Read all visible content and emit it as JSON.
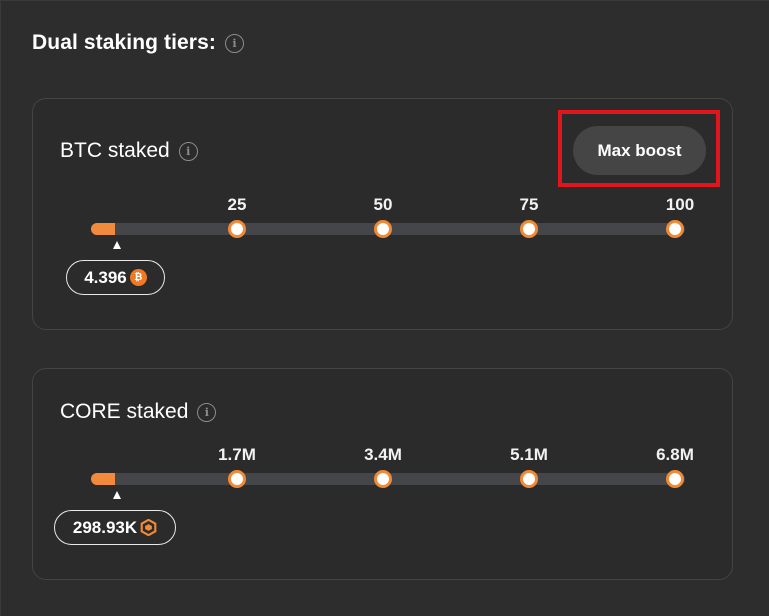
{
  "section": {
    "title": "Dual staking tiers:",
    "info_icon": "info-icon"
  },
  "btc_card": {
    "label": "BTC staked",
    "boost_button": "Max boost",
    "ticks": [
      "25",
      "50",
      "75",
      "100"
    ],
    "value": "4.396",
    "coin_icon": "bitcoin-icon",
    "progress_fraction": 0.04
  },
  "core_card": {
    "label": "CORE staked",
    "ticks": [
      "1.7M",
      "3.4M",
      "5.1M",
      "6.8M"
    ],
    "value": "298.93K",
    "coin_icon": "core-icon",
    "progress_fraction": 0.04
  },
  "colors": {
    "accent": "#f28a3e",
    "track": "#444649",
    "highlight": "#e2141c"
  }
}
